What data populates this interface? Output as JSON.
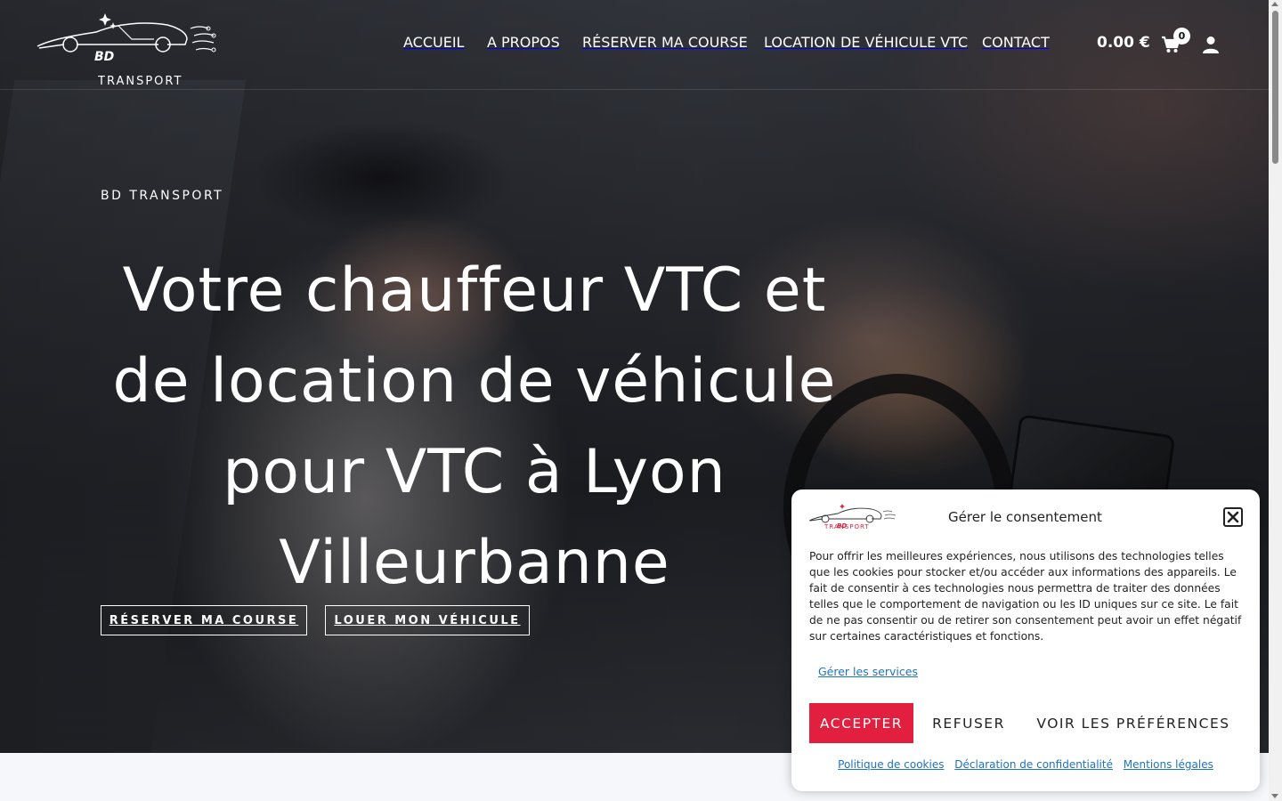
{
  "header": {
    "logo_text": "TRANSPORT",
    "logo_monogram": "BD",
    "nav": [
      {
        "label": "ACCUEIL"
      },
      {
        "label": "A PROPOS"
      },
      {
        "label": "RÉSERVER MA COURSE"
      },
      {
        "label": "LOCATION DE VÉHICULE VTC"
      },
      {
        "label": "CONTACT"
      }
    ],
    "cart_total": "0.00 €",
    "cart_count": "0",
    "icons": {
      "cart": "cart-icon",
      "user": "user-icon"
    }
  },
  "hero": {
    "eyebrow": "BD TRANSPORT",
    "title": "Votre chauffeur VTC et de location de véhicule pour VTC à Lyon Villeurbanne",
    "buttons": {
      "book": "RÉSERVER MA COURSE",
      "rent": "LOUER MON VÉHICULE"
    }
  },
  "consent": {
    "logo_text": "TRANSPORT",
    "title": "Gérer le consentement",
    "body": "Pour offrir les meilleures expériences, nous utilisons des technologies telles que les cookies pour stocker et/ou accéder aux informations des appareils. Le fait de consentir à ces technologies nous permettra de traiter des données telles que le comportement de navigation ou les ID uniques sur ce site. Le fait de ne pas consentir ou de retirer son consentement peut avoir un effet négatif sur certaines caractéristiques et fonctions.",
    "manage_services": "Gérer les services",
    "accept": "ACCEPTER",
    "refuse": "REFUSER",
    "preferences": "VOIR LES PRÉFÉRENCES",
    "links": {
      "cookies": "Politique de cookies",
      "privacy": "Déclaration de confidentialité",
      "legal": "Mentions légales"
    }
  },
  "colors": {
    "accent": "#e21f3f",
    "link": "#1e73be",
    "white": "#ffffff"
  }
}
